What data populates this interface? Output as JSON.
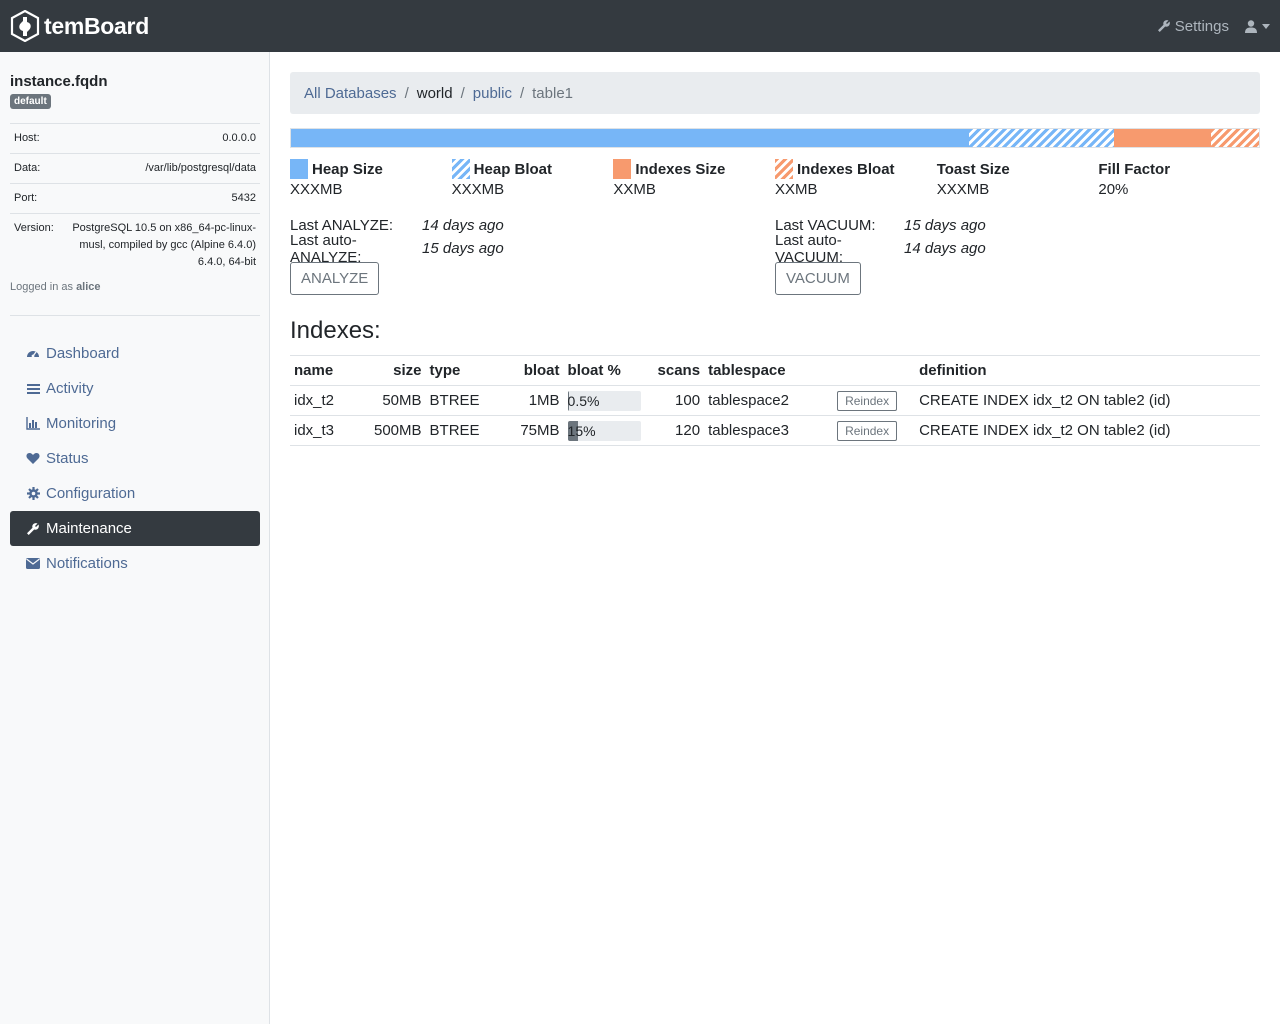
{
  "app": {
    "brand": "temBoard"
  },
  "navbar": {
    "settings_label": "Settings"
  },
  "instance": {
    "name": "instance.fqdn",
    "badge": "default",
    "info": [
      {
        "key": "Host:",
        "value": "0.0.0.0"
      },
      {
        "key": "Data:",
        "value": "/var/lib/postgresql/data"
      },
      {
        "key": "Port:",
        "value": "5432"
      },
      {
        "key": "Version:",
        "value": "PostgreSQL 10.5 on x86_64-pc-linux-musl, compiled by gcc (Alpine 6.4.0) 6.4.0, 64-bit"
      }
    ],
    "logged_prefix": "Logged in as",
    "user": "alice"
  },
  "menu": [
    {
      "label": "Dashboard",
      "icon": "dashboard-icon",
      "active": false
    },
    {
      "label": "Activity",
      "icon": "list-icon",
      "active": false
    },
    {
      "label": "Monitoring",
      "icon": "bar-chart-icon",
      "active": false
    },
    {
      "label": "Status",
      "icon": "heart-icon",
      "active": false
    },
    {
      "label": "Configuration",
      "icon": "gear-icon",
      "active": false
    },
    {
      "label": "Maintenance",
      "icon": "wrench-icon",
      "active": true
    },
    {
      "label": "Notifications",
      "icon": "envelope-icon",
      "active": false
    }
  ],
  "breadcrumb": {
    "all": "All Databases",
    "db": "world",
    "schema": "public",
    "table": "table1"
  },
  "size_bar": {
    "heap": 0.7,
    "heap_bloat": 0.15,
    "indexes": 0.1,
    "indexes_bloat": 0.05
  },
  "legend": [
    {
      "title": "Heap Size",
      "value": "XXXMB"
    },
    {
      "title": "Heap Bloat",
      "value": "XXXMB"
    },
    {
      "title": "Indexes Size",
      "value": "XXMB"
    },
    {
      "title": "Indexes Bloat",
      "value": "XXMB"
    },
    {
      "title": "Toast Size",
      "value": "XXXMB"
    },
    {
      "title": "Fill Factor",
      "value": "20%"
    }
  ],
  "colors": {
    "heap": "#77b6f7",
    "indexes": "#f79a6e",
    "dark": "#343a40",
    "link": "#4e6a94"
  },
  "maintenance": {
    "last_analyze_label": "Last ANALYZE:",
    "last_analyze": "14 days ago",
    "last_autoanalyze_label": "Last auto-ANALYZE:",
    "last_autoanalyze": "15 days ago",
    "analyze_button": "ANALYZE",
    "last_vacuum_label": "Last VACUUM:",
    "last_vacuum": "15 days ago",
    "last_autovacuum_label": "Last auto-VACUUM:",
    "last_autovacuum": "14 days ago",
    "vacuum_button": "VACUUM"
  },
  "indexes": {
    "heading": "Indexes:",
    "columns": {
      "name": "name",
      "size": "size",
      "type": "type",
      "bloat": "bloat",
      "bloat_pct": "bloat %",
      "scans": "scans",
      "tablespace": "tablespace",
      "definition": "definition"
    },
    "reindex_label": "Reindex",
    "rows": [
      {
        "name": "idx_t2",
        "size": "50MB",
        "type": "BTREE",
        "bloat": "1MB",
        "bloat_pct": "0.5%",
        "bloat_fraction": 0.005,
        "scans": "100",
        "tablespace": "tablespace2",
        "definition": "CREATE INDEX idx_t2 ON table2 (id)"
      },
      {
        "name": "idx_t3",
        "size": "500MB",
        "type": "BTREE",
        "bloat": "75MB",
        "bloat_pct": "15%",
        "bloat_fraction": 0.15,
        "scans": "120",
        "tablespace": "tablespace3",
        "definition": "CREATE INDEX idx_t2 ON table2 (id)"
      }
    ]
  }
}
